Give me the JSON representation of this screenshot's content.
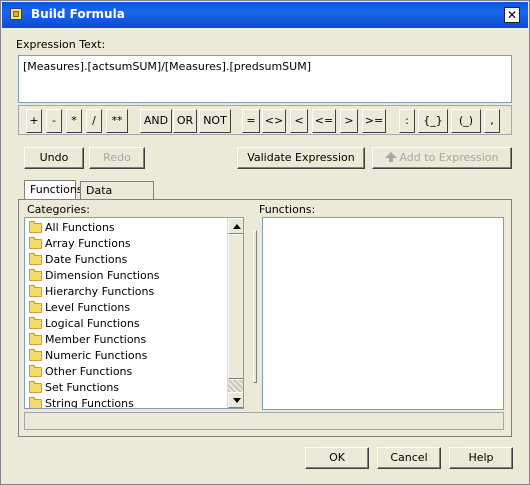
{
  "window": {
    "title": "Build Formula",
    "close_label": "✕"
  },
  "expression": {
    "label": "Expression Text:",
    "value": "[Measures].[actsumSUM]/[Measures].[predsumSUM]"
  },
  "operators": [
    "+",
    "-",
    "*",
    "/",
    "**",
    "AND",
    "OR",
    "NOT",
    "=",
    "<>",
    "<",
    "<=",
    ">",
    ">=",
    ":",
    "{_}",
    "(_)",
    ","
  ],
  "buttons": {
    "undo": "Undo",
    "redo": "Redo",
    "validate": "Validate Expression",
    "add": "Add to Expression",
    "ok": "OK",
    "cancel": "Cancel",
    "help": "Help"
  },
  "tabs": {
    "functions": "Functions",
    "data_sources": "Data Sources"
  },
  "categories_label": "Categories:",
  "functions_label": "Functions:",
  "categories": [
    "All Functions",
    "Array Functions",
    "Date Functions",
    "Dimension Functions",
    "Hierarchy Functions",
    "Level Functions",
    "Logical Functions",
    "Member Functions",
    "Numeric Functions",
    "Other Functions",
    "Set Functions",
    "String Functions"
  ],
  "icons": {
    "folder": "folder-icon",
    "scroll_up": "arrow-up-icon",
    "scroll_down": "arrow-down-icon",
    "add": "arrow-up-icon"
  },
  "colors": {
    "titlebar": "#0a54e0",
    "dialog_bg": "#ece9d8",
    "field_border": "#7f9db9",
    "folder": "#f4d96b"
  }
}
